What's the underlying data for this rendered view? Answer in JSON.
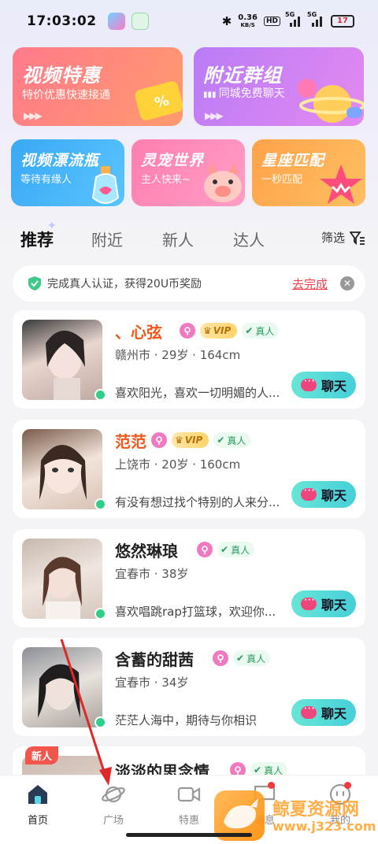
{
  "status_bar": {
    "time": "17:03:02",
    "network_speed_value": "0.36",
    "network_speed_unit": "KB/S",
    "hd_label": "HD",
    "signal_1": "5G",
    "signal_2": "5G",
    "battery": "17"
  },
  "feature_cards": {
    "video_deal": {
      "title": "视频特惠",
      "subtitle": "特价优惠快速接通"
    },
    "nearby_group": {
      "title": "附近群组",
      "subtitle": "同城免费聊天"
    },
    "video_bottle": {
      "title": "视频漂流瓶",
      "subtitle": "等待有缘人"
    },
    "pet_world": {
      "title": "灵宠世界",
      "subtitle": "主人快来~"
    },
    "zodiac_match": {
      "title": "星座匹配",
      "subtitle": "一秒匹配"
    }
  },
  "tabs": [
    "推荐",
    "附近",
    "新人",
    "达人"
  ],
  "filter_label": "筛选",
  "verify_banner": {
    "text": "完成真人认证，获得20U币奖励",
    "action": "去完成"
  },
  "badges": {
    "vip": "VIP",
    "real": "真人",
    "new": "新人"
  },
  "chat_label": "聊天",
  "users": [
    {
      "name": "、心弦",
      "vip": true,
      "meta": "赣州市 · 29岁 · 164cm",
      "bio": "喜欢阳光，喜欢一切明媚的人..."
    },
    {
      "name": "范范",
      "vip": true,
      "meta": "上饶市 · 20岁 · 160cm",
      "bio": "有没有想过找个特别的人来分..."
    },
    {
      "name": "悠然琳琅",
      "vip": false,
      "meta": "宜春市 · 38岁",
      "bio": "喜欢唱跳rap打篮球，欢迎你..."
    },
    {
      "name": "含蓄的甜茜",
      "vip": false,
      "meta": "宜春市 · 34岁",
      "bio": "茫茫人海中，期待与你相识"
    },
    {
      "name": "淡淡的思念情",
      "vip": false,
      "meta": "",
      "bio": ""
    }
  ],
  "bottom_nav": [
    {
      "label": "首页",
      "icon": "home-icon"
    },
    {
      "label": "广场",
      "icon": "planet-icon"
    },
    {
      "label": "特惠",
      "icon": "video-camera-icon"
    },
    {
      "label": "消息",
      "icon": "message-icon"
    },
    {
      "label": "我的",
      "icon": "profile-icon"
    }
  ],
  "watermark": {
    "text": "鲸夏资源网",
    "url": "www.j323.com"
  }
}
